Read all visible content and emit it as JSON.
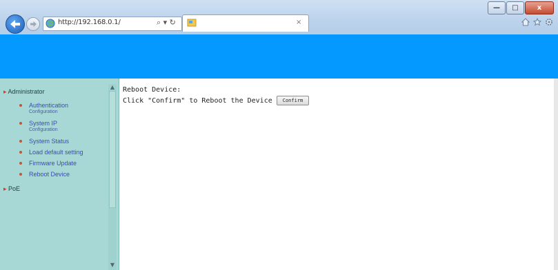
{
  "browser": {
    "url": "http://192.168.0.1/",
    "search_tools": "⌕ ▾ ↻",
    "tab_close": "×",
    "window_controls": {
      "minimize": "—",
      "maximize": "□",
      "close": "x"
    }
  },
  "colors": {
    "banner": "#0399ff",
    "sidebar": "#a7d8d5"
  },
  "sidebar": {
    "section": "Administrator",
    "items": [
      {
        "label": "Authentication",
        "sub": "Configuration"
      },
      {
        "label": "System IP",
        "sub": "Configuration"
      },
      {
        "label": "System Status",
        "sub": ""
      },
      {
        "label": "Load default setting",
        "sub": ""
      },
      {
        "label": "Firmware Update",
        "sub": ""
      },
      {
        "label": "Reboot Device",
        "sub": ""
      }
    ],
    "section2": "PoE"
  },
  "main": {
    "title": "Reboot Device:",
    "instruction": "Click \"Confirm\" to Reboot the Device",
    "confirm_label": "Confirm"
  }
}
